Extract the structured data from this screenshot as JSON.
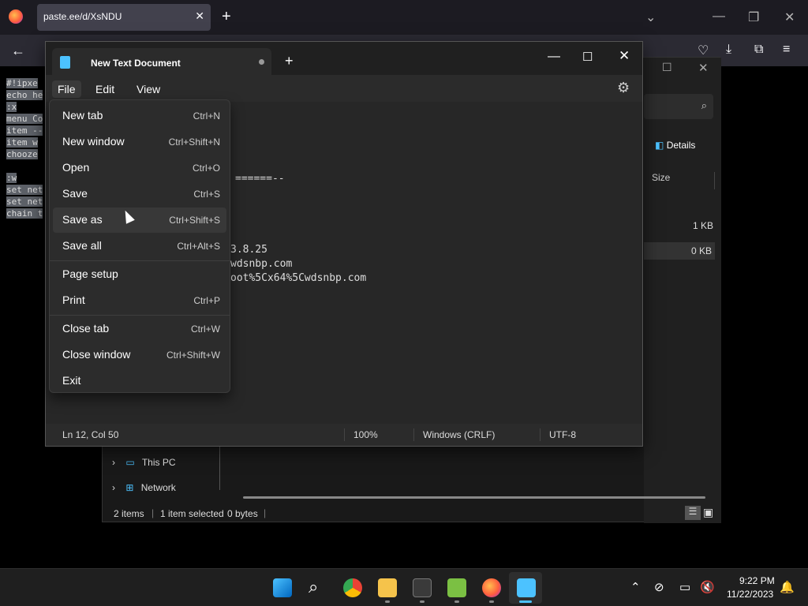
{
  "browser": {
    "tab_title": "paste.ee/d/XsNDU",
    "tab_close": "✕",
    "new_tab": "+",
    "paste_lines": [
      "#!ipxe",
      "echo he",
      ":x",
      "menu Co",
      "item --",
      "item w",
      "chooze",
      "",
      ":w",
      "set net",
      "set net",
      "chain t"
    ]
  },
  "explorer": {
    "details_label": "Details",
    "size_column": "Size",
    "file_sizes": [
      "1 KB",
      "0 KB"
    ],
    "nav_items": [
      {
        "label": "This PC"
      },
      {
        "label": "Network"
      }
    ],
    "status": {
      "items": "2 items",
      "selected": "1 item selected",
      "bytes": "0 bytes"
    }
  },
  "notepad": {
    "tab_title": "New Text Document",
    "menus": [
      "File",
      "Edit",
      "View"
    ],
    "editor_lines": [
      {
        "text": "======--"
      },
      {
        "text": "3.8.25"
      },
      {
        "text": "wdsnbp.com"
      },
      {
        "text": "oot%5Cx64%5Cwdsnbp.com"
      }
    ],
    "status": {
      "position": "Ln 12, Col 50",
      "zoom": "100%",
      "line_ending": "Windows (CRLF)",
      "encoding": "UTF-8"
    }
  },
  "file_menu": [
    {
      "label": "New tab",
      "shortcut": "Ctrl+N"
    },
    {
      "label": "New window",
      "shortcut": "Ctrl+Shift+N"
    },
    {
      "label": "Open",
      "shortcut": "Ctrl+O"
    },
    {
      "label": "Save",
      "shortcut": "Ctrl+S"
    },
    {
      "label": "Save as",
      "shortcut": "Ctrl+Shift+S"
    },
    {
      "label": "Save all",
      "shortcut": "Ctrl+Alt+S"
    },
    {
      "label": "Page setup",
      "shortcut": ""
    },
    {
      "label": "Print",
      "shortcut": "Ctrl+P"
    },
    {
      "label": "Close tab",
      "shortcut": "Ctrl+W"
    },
    {
      "label": "Close window",
      "shortcut": "Ctrl+Shift+W"
    },
    {
      "label": "Exit",
      "shortcut": ""
    }
  ],
  "taskbar": {
    "time": "9:22 PM",
    "date": "11/22/2023",
    "accent": "#4cc2ff"
  }
}
